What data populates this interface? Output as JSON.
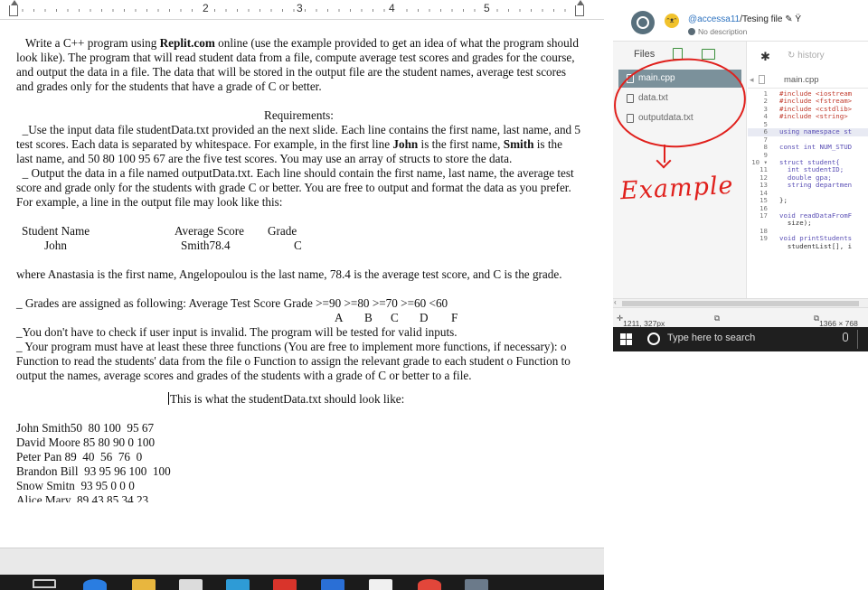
{
  "document": {
    "ruler_numbers": [
      "2",
      "3",
      "4",
      "5"
    ],
    "intro": [
      "Write a C++ program using ",
      "Replit.com",
      " online (use the example provided to get an idea of what the program should look like). The program that will read student data from a file, compute average test scores and grades for the course, and output the data in a file. The data that will be stored in the output file are the student names, average test scores and grades only for the students that have a grade of C or better."
    ],
    "requirements_heading": "Requirements:",
    "req1": [
      "_Use the input data file studentData.txt provided an the next slide. Each line contains the first name, last name, and 5 test scores. Each data is separated by whitespace. For example, in the first line ",
      "John",
      " is the first name, ",
      "Smith",
      " is the last name, and 50 80 100 95 67 are the five test scores. You may use an array of structs to store the data."
    ],
    "req2": "_ Output the data in a file named outputData.txt. Each line should contain the first name, last name, the average test score and grade only for the students with grade C or better. You are free to output and format the data as you prefer. For example, a line in the output file may look like this:",
    "table_header": {
      "name": "Student Name",
      "score": "Average Score",
      "grade": "Grade"
    },
    "table_row": {
      "name": "John",
      "score": "Smith78.4",
      "grade": "C"
    },
    "where_text": "where Anastasia is the first name, Angelopoulou is the last name, 78.4 is the average test score, and C is the grade.",
    "grades_line": "_ Grades are assigned as following: Average Test Score Grade >=90 >=80 >=70 >=60 <60",
    "grade_letters": [
      "A",
      "B",
      "C",
      "D",
      "F"
    ],
    "req_invalid": "_You don't have to check if user input is invalid. The program will be tested for valid inputs.",
    "req_functions": "_ Your program must have at least these three functions (You are free to implement more functions, if necessary): o Function to read the students' data from the file o Function to assign the relevant grade to each student o Function to output the names, average scores and grades of the students with a grade of C or better to a file.",
    "sample_heading": "This is what the studentData.txt should look like:",
    "sample_lines": [
      "John Smith50  80 100  95 67",
      "David Moore 85 80 90 0 100",
      "Peter Pan 89  40  56  76  0",
      "Brandon Bill  93 95 96 100  100",
      "Snow Smitn  93 95 0 0 0",
      "Alice Mary  89 43 85 34 23"
    ]
  },
  "replit": {
    "user": "@accessa11",
    "repl_name": "/Tesing file",
    "edit_marks": "✎ Ÿ",
    "description": "No description",
    "files_label": "Files",
    "history_label": "history",
    "files": [
      "main.cpp",
      "data.txt",
      "outputdata.txt"
    ],
    "open_tab": "main.cpp",
    "code_lines": [
      {
        "n": "1",
        "t": "#include <iostream"
      },
      {
        "n": "2",
        "t": "#include <fstream>"
      },
      {
        "n": "3",
        "t": "#include <cstdlib>"
      },
      {
        "n": "4",
        "t": "#include <string>"
      },
      {
        "n": "5",
        "t": ""
      },
      {
        "n": "6",
        "t": "using namespace st"
      },
      {
        "n": "7",
        "t": ""
      },
      {
        "n": "8",
        "t": "const int NUM_STUD"
      },
      {
        "n": "9",
        "t": ""
      },
      {
        "n": "10 ▾",
        "t": "struct student{"
      },
      {
        "n": "11",
        "t": "  int studentID;"
      },
      {
        "n": "12",
        "t": "  double gpa;"
      },
      {
        "n": "13",
        "t": "  string departmen"
      },
      {
        "n": "14",
        "t": ""
      },
      {
        "n": "15",
        "t": "};"
      },
      {
        "n": "16",
        "t": ""
      },
      {
        "n": "17",
        "t": "void readDataFromF"
      },
      {
        "n": "",
        "t": "  size);"
      },
      {
        "n": "18",
        "t": ""
      },
      {
        "n": "19",
        "t": "void printStudents"
      },
      {
        "n": "",
        "t": "  studentList[], i"
      }
    ],
    "status_cursor": "1211, 327px",
    "status_size": "1366 × 768"
  },
  "annotation": {
    "text": "Example"
  },
  "taskbar": {
    "search_placeholder": "Type here to search"
  },
  "colors": {
    "annotation_red": "#e0201c",
    "replit_active_file": "#7b919b",
    "taskbar": "#1f1f1f"
  }
}
